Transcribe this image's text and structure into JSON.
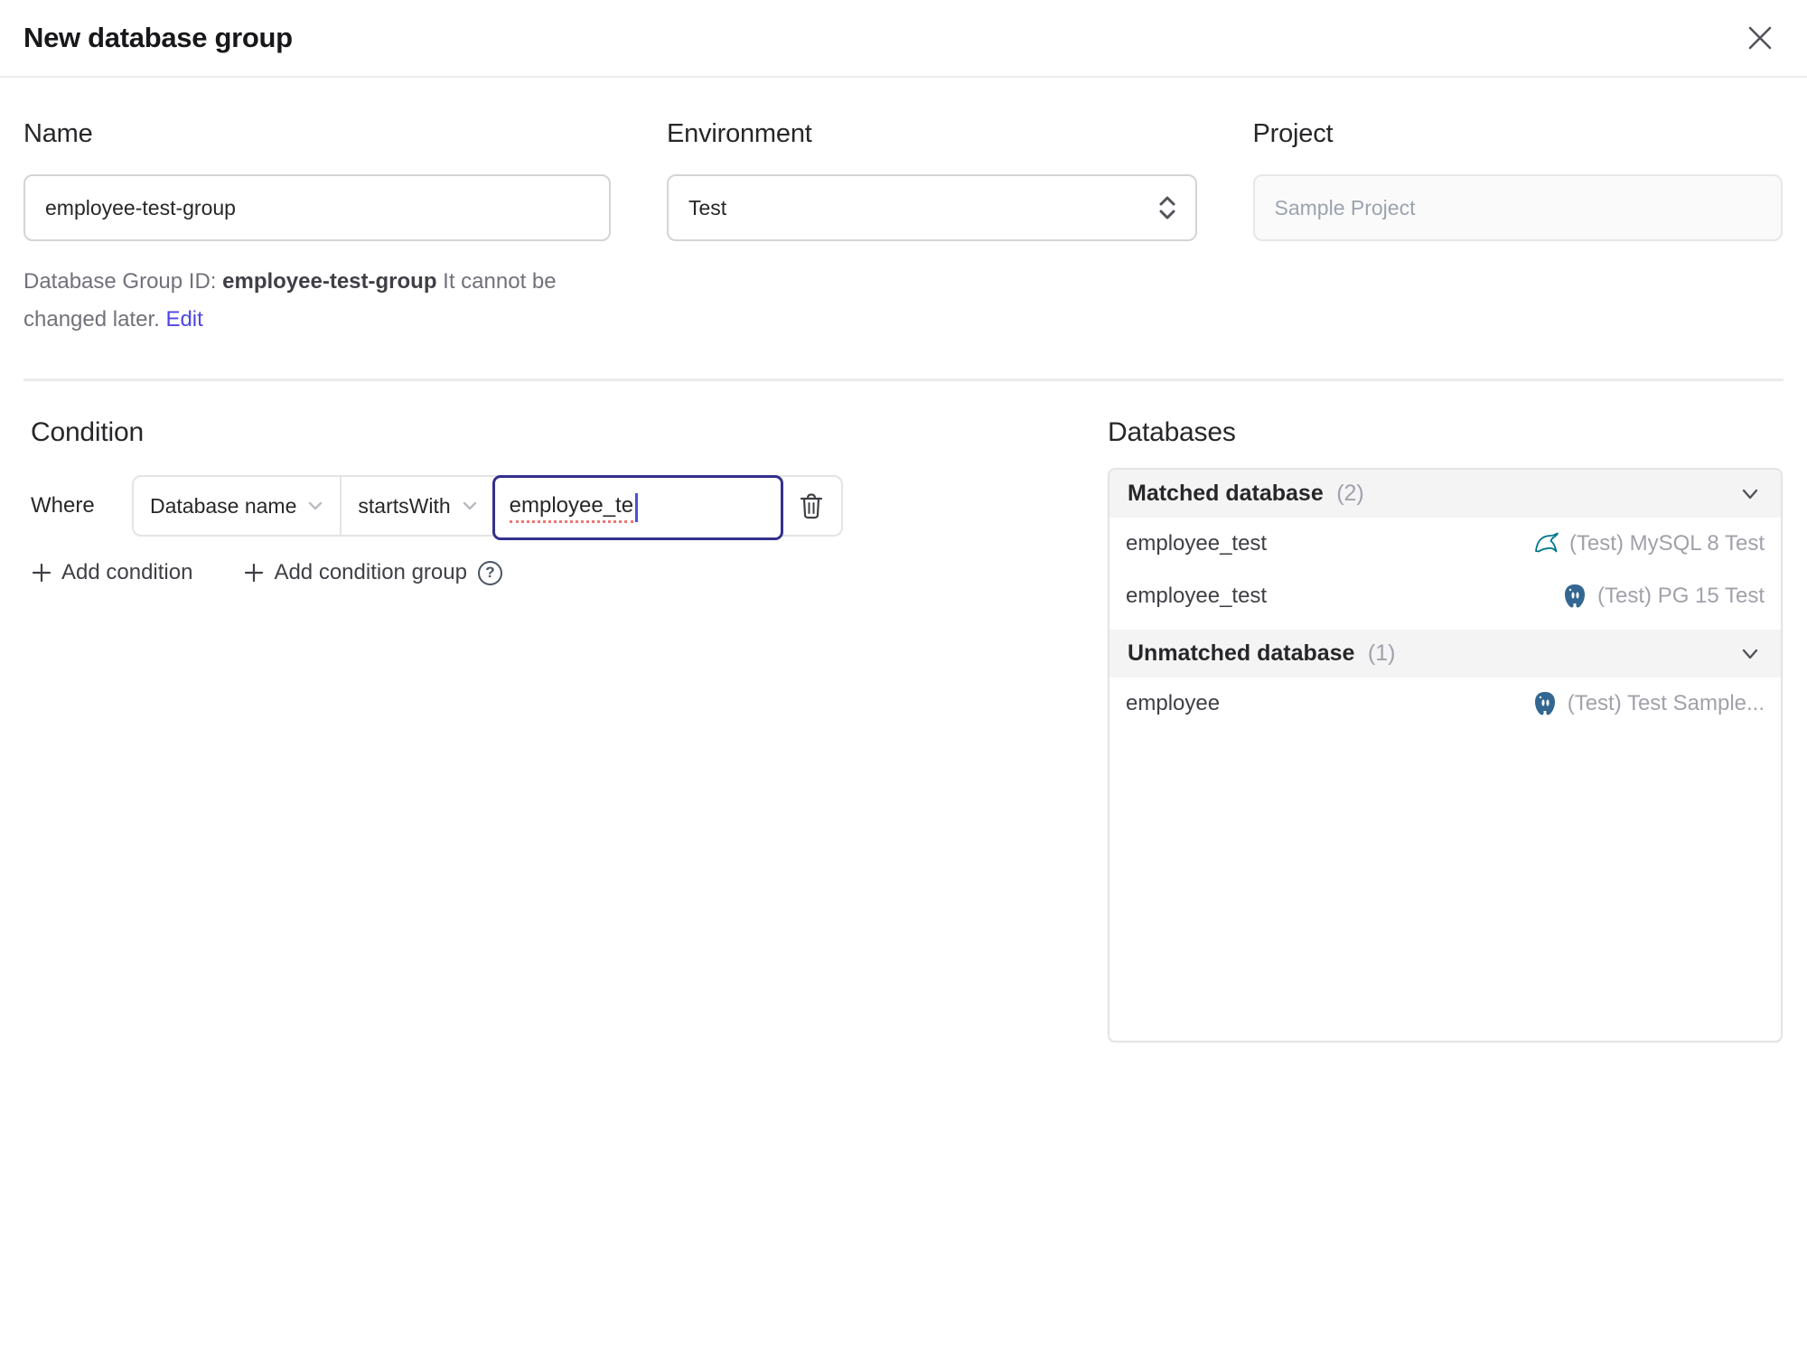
{
  "dialog": {
    "title": "New database group"
  },
  "form": {
    "name": {
      "label": "Name",
      "value": "employee-test-group"
    },
    "environment": {
      "label": "Environment",
      "value": "Test"
    },
    "project": {
      "label": "Project",
      "value": "Sample Project"
    }
  },
  "group_id_note": {
    "prefix": "Database Group ID: ",
    "id": "employee-test-group",
    "suffix": " It cannot be changed later. ",
    "edit_label": "Edit"
  },
  "condition": {
    "heading": "Condition",
    "where_label": "Where",
    "field_selected": "Database name",
    "operator_selected": "startsWith",
    "value": "employee_te",
    "add_condition_label": "Add condition",
    "add_condition_group_label": "Add condition group"
  },
  "databases": {
    "heading": "Databases",
    "sections": [
      {
        "title": "Matched database",
        "count": "(2)",
        "rows": [
          {
            "name": "employee_test",
            "engine": "mysql",
            "instance": "(Test) MySQL 8 Test"
          },
          {
            "name": "employee_test",
            "engine": "postgres",
            "instance": "(Test) PG 15 Test"
          }
        ]
      },
      {
        "title": "Unmatched database",
        "count": "(1)",
        "rows": [
          {
            "name": "employee",
            "engine": "postgres",
            "instance": "(Test) Test Sample..."
          }
        ]
      }
    ]
  },
  "colors": {
    "accent_link": "#4f46e5",
    "focused_input_border": "#34308f",
    "spellcheck_underline": "#f07575",
    "mysql_icon": "#00758f",
    "postgres_icon": "#336791",
    "section_header_bg": "#f4f4f5",
    "muted_text": "#a1a1aa"
  }
}
